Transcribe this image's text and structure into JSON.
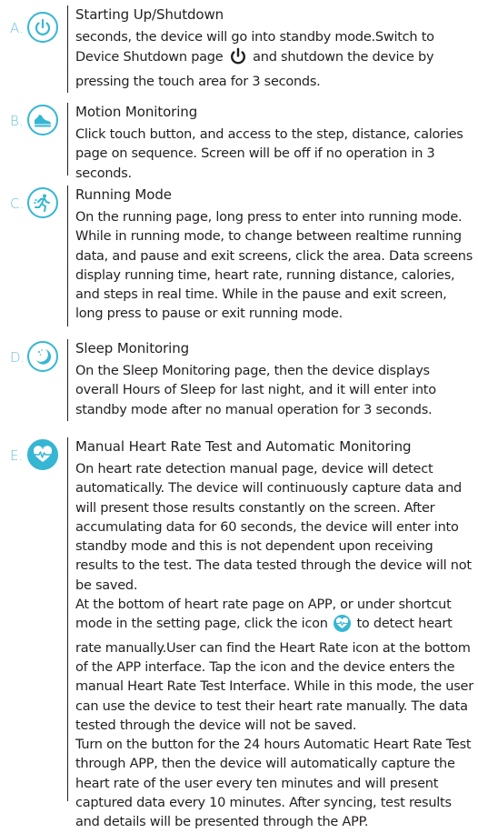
{
  "sections": [
    {
      "letter": "A.",
      "icon": "power-icon",
      "title": "Starting Up/Shutdown",
      "body_before_icon": "seconds, the device will go into standby mode.Switch to Device Shutdown page",
      "body_after_icon": "and shutdown the device by pressing the touch area for 3 seconds."
    },
    {
      "letter": "B.",
      "icon": "shoe-icon",
      "title": "Motion Monitoring",
      "body": "Click touch button,  and access to the step, distance, calories page on sequence. Screen will be off if no operation in 3 seconds."
    },
    {
      "letter": "C.",
      "icon": "running-person-icon",
      "title": "Running Mode",
      "body": "On the running page, long press to enter into running mode. While in running mode, to change between realtime running data, and pause and exit screens, click the area. Data screens display running time, heart rate, running distance, calories, and steps in real time. While in the pause and exit screen, long press to pause or exit running mode."
    },
    {
      "letter": "D.",
      "icon": "moon-icon",
      "title": "Sleep Monitoring",
      "body": "On the Sleep Monitoring page, then the device displays overall Hours of Sleep for last night, and it will enter into standby mode after no manual operation for 3 seconds."
    },
    {
      "letter": "E.",
      "icon": "heart-rate-icon",
      "title": "Manual Heart Rate Test and Automatic Monitoring",
      "paragraph1": "On heart rate detection manual page, device will detect automatically. The device will continuously capture data and will present those results constantly on the screen. After accumulating data for 60 seconds, the device will enter into standby mode and this is not dependent upon receiving results to the test.  The data tested through the device will not be saved.",
      "paragraph2_before_icon": "At the bottom of heart rate page on APP, or under shortcut mode in the setting page, click the icon",
      "paragraph2_after_icon": "to detect heart rate manually.User can find the Heart Rate icon at the bottom of the APP interface. Tap the icon and the device enters the manual Heart Rate Test Interface. While in this mode, the user can use the device to test their heart rate manually. The data tested through the device will not be saved.",
      "paragraph3": "Turn on the button for the 24 hours Automatic Heart Rate Test through APP, then the device will automatically capture the heart rate of the user every ten minutes and will present captured data every 10 minutes. After syncing, test results and details will be presented through the APP."
    }
  ],
  "colors": {
    "accent": "#36b6d3",
    "letter": "#67c2d8",
    "text": "#231f20"
  }
}
